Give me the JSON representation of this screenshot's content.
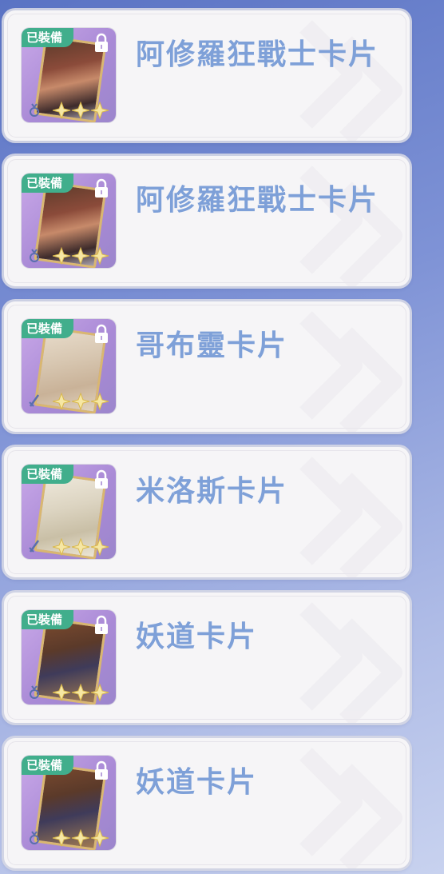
{
  "cards": [
    {
      "name": "阿修羅狂戰士卡片",
      "badge": "已裝備",
      "art": "asura",
      "type_icon": "ring-icon"
    },
    {
      "name": "阿修羅狂戰士卡片",
      "badge": "已裝備",
      "art": "asura",
      "type_icon": "ring-icon"
    },
    {
      "name": "哥布靈卡片",
      "badge": "已裝備",
      "art": "goblin",
      "type_icon": "sword-icon"
    },
    {
      "name": "米洛斯卡片",
      "badge": "已裝備",
      "art": "milos",
      "type_icon": "sword-icon"
    },
    {
      "name": "妖道卡片",
      "badge": "已裝備",
      "art": "daoist",
      "type_icon": "ring-icon"
    },
    {
      "name": "妖道卡片",
      "badge": "已裝備",
      "art": "daoist",
      "type_icon": "ring-icon"
    }
  ],
  "colors": {
    "badge": "#41ae8c",
    "title": "#7ea0d8",
    "thumb_bg": "#a98ad6",
    "star": "#e8c95a"
  }
}
